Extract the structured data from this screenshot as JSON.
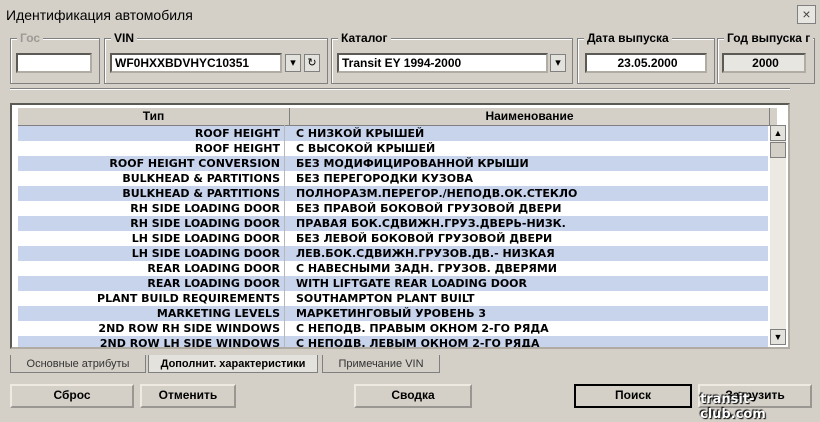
{
  "window": {
    "title": "Идентификация автомобиля",
    "close_glyph": "×"
  },
  "groups": {
    "gos": {
      "label": "Гос",
      "value": ""
    },
    "vin": {
      "label": "VIN",
      "value": "WF0HXXBDVHYC10351"
    },
    "catalog": {
      "label": "Каталог",
      "value": "Transit EY 1994-2000"
    },
    "release_date": {
      "label": "Дата выпуска",
      "value": "23.05.2000"
    },
    "release_year": {
      "label": "Год выпуска г",
      "value": "2000"
    }
  },
  "grid": {
    "columns": [
      "Тип",
      "Наименование"
    ],
    "rows": [
      {
        "type": "ROOF HEIGHT",
        "name": "С НИЗКОЙ КРЫШЕЙ"
      },
      {
        "type": "ROOF HEIGHT",
        "name": "С ВЫСОКОЙ КРЫШЕЙ"
      },
      {
        "type": "ROOF HEIGHT CONVERSION",
        "name": "БЕЗ МОДИФИЦИРОВАННОЙ КРЫШИ"
      },
      {
        "type": "BULKHEAD & PARTITIONS",
        "name": "БЕЗ ПЕРЕГОРОДКИ КУЗОВА"
      },
      {
        "type": "BULKHEAD & PARTITIONS",
        "name": "ПОЛНОРАЗМ.ПЕРЕГОР./НЕПОДВ.ОК.СТЕКЛО"
      },
      {
        "type": "RH SIDE LOADING DOOR",
        "name": "БЕЗ ПРАВОЙ БОКОВОЙ ГРУЗОВОЙ ДВЕРИ"
      },
      {
        "type": "RH SIDE LOADING DOOR",
        "name": "ПРАВАЯ БОК.СДВИЖН.ГРУЗ.ДВЕРЬ-НИЗК."
      },
      {
        "type": "LH SIDE LOADING DOOR",
        "name": "БЕЗ ЛЕВОЙ БОКОВОЙ ГРУЗОВОЙ ДВЕРИ"
      },
      {
        "type": "LH SIDE LOADING DOOR",
        "name": "ЛЕВ.БОК.СДВИЖН.ГРУЗОВ.ДВ.- НИЗКАЯ"
      },
      {
        "type": "REAR LOADING DOOR",
        "name": "С НАВЕСНЫМИ ЗАДН. ГРУЗОВ. ДВЕРЯМИ"
      },
      {
        "type": "REAR LOADING DOOR",
        "name": "WITH LIFTGATE REAR LOADING DOOR"
      },
      {
        "type": "PLANT BUILD REQUIREMENTS",
        "name": "SOUTHAMPTON PLANT BUILT"
      },
      {
        "type": "MARKETING LEVELS",
        "name": "МАРКЕТИНГОВЫЙ УРОВЕНЬ 3"
      },
      {
        "type": "2ND ROW RH SIDE WINDOWS",
        "name": "С НЕПОДВ. ПРАВЫМ ОКНОМ 2-ГО РЯДА"
      },
      {
        "type": "2ND ROW LH SIDE WINDOWS",
        "name": "С НЕПОДВ. ЛЕВЫМ ОКНОМ 2-ГО РЯДА"
      }
    ],
    "row_alt_color": "#c8d3ec"
  },
  "tabs": [
    {
      "label": "Основные атрибуты"
    },
    {
      "label": "Дополнит. характеристики",
      "active": true
    },
    {
      "label": "Примечание VIN"
    }
  ],
  "buttons": {
    "reset": "Сброс",
    "cancel": "Отменить",
    "summary": "Сводка",
    "search": "Поиск",
    "load": "Загрузить"
  },
  "watermark": "transit-club.com"
}
